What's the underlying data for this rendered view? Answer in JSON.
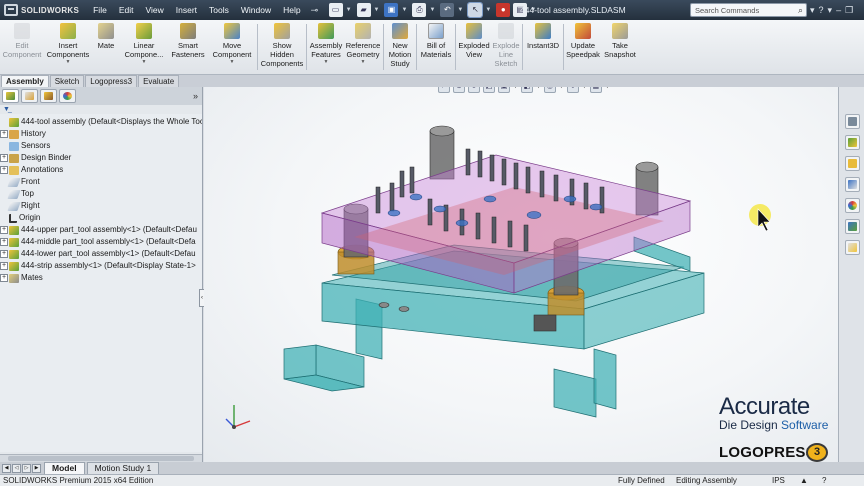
{
  "app": {
    "logo_text": "SOLIDWORKS",
    "document_title": "444-tool assembly.SLDASM",
    "search_placeholder": "Search Commands",
    "menus": [
      "File",
      "Edit",
      "View",
      "Insert",
      "Tools",
      "Window",
      "Help"
    ]
  },
  "commands": [
    {
      "label": "Edit Component",
      "icon": "edit-component-icon",
      "disabled": true,
      "dropdown": false
    },
    {
      "label": "Insert Components",
      "icon": "insert-components-icon",
      "disabled": false,
      "dropdown": true
    },
    {
      "label": "Mate",
      "icon": "mate-icon",
      "disabled": false,
      "dropdown": false
    },
    {
      "label": "Linear Compone...",
      "icon": "linear-pattern-icon",
      "disabled": false,
      "dropdown": true
    },
    {
      "label": "Smart Fasteners",
      "icon": "smart-fasteners-icon",
      "disabled": false,
      "dropdown": false
    },
    {
      "label": "Move Component",
      "icon": "move-component-icon",
      "disabled": false,
      "dropdown": true
    },
    {
      "label": "Show Hidden Components",
      "icon": "show-hidden-icon",
      "disabled": false,
      "dropdown": false
    },
    {
      "label": "Assembly Features",
      "icon": "assembly-features-icon",
      "disabled": false,
      "dropdown": true
    },
    {
      "label": "Reference Geometry",
      "icon": "reference-geometry-icon",
      "disabled": false,
      "dropdown": true
    },
    {
      "label": "New Motion Study",
      "icon": "new-motion-study-icon",
      "disabled": false,
      "dropdown": false
    },
    {
      "label": "Bill of Materials",
      "icon": "bill-of-materials-icon",
      "disabled": false,
      "dropdown": false
    },
    {
      "label": "Exploded View",
      "icon": "exploded-view-icon",
      "disabled": false,
      "dropdown": false
    },
    {
      "label": "Explode Line Sketch",
      "icon": "explode-line-sketch-icon",
      "disabled": true,
      "dropdown": false
    },
    {
      "label": "Instant3D",
      "icon": "instant3d-icon",
      "disabled": false,
      "dropdown": false
    },
    {
      "label": "Update Speedpak",
      "icon": "update-speedpak-icon",
      "disabled": false,
      "dropdown": false
    },
    {
      "label": "Take Snapshot",
      "icon": "take-snapshot-icon",
      "disabled": false,
      "dropdown": false
    }
  ],
  "command_tabs": [
    {
      "label": "Assembly",
      "active": true
    },
    {
      "label": "Sketch",
      "active": false
    },
    {
      "label": "Logopress3",
      "active": false
    },
    {
      "label": "Evaluate",
      "active": false
    }
  ],
  "tree": [
    {
      "label": "444-tool assembly  (Default<Displays the Whole Too",
      "icon": "assembly-icon",
      "expander": "",
      "indent": 0
    },
    {
      "label": "History",
      "icon": "history-icon",
      "expander": "+",
      "indent": 1
    },
    {
      "label": "Sensors",
      "icon": "sensors-icon",
      "expander": "",
      "indent": 1
    },
    {
      "label": "Design Binder",
      "icon": "design-binder-icon",
      "expander": "+",
      "indent": 1
    },
    {
      "label": "Annotations",
      "icon": "annotations-icon",
      "expander": "+",
      "indent": 1
    },
    {
      "label": "Front",
      "icon": "plane-icon",
      "expander": "",
      "indent": 1
    },
    {
      "label": "Top",
      "icon": "plane-icon",
      "expander": "",
      "indent": 1
    },
    {
      "label": "Right",
      "icon": "plane-icon",
      "expander": "",
      "indent": 1
    },
    {
      "label": "Origin",
      "icon": "origin-icon",
      "expander": "",
      "indent": 1
    },
    {
      "label": "444-upper part_tool assembly<1> (Default<Defau",
      "icon": "subassembly-icon",
      "expander": "+",
      "indent": 1
    },
    {
      "label": "444-middle part_tool assembly<1> (Default<Defa",
      "icon": "subassembly-icon",
      "expander": "+",
      "indent": 1
    },
    {
      "label": "444-lower part_tool assembly<1> (Default<Defau",
      "icon": "subassembly-icon",
      "expander": "+",
      "indent": 1
    },
    {
      "label": "444-strip assembly<1> (Default<Display State-1>",
      "icon": "subassembly-icon",
      "expander": "+",
      "indent": 1
    },
    {
      "label": "Mates",
      "icon": "mates-icon",
      "expander": "+",
      "indent": 1
    }
  ],
  "bottom_tabs": [
    {
      "label": "Model",
      "active": true
    },
    {
      "label": "Motion Study 1",
      "active": false
    }
  ],
  "status": {
    "edition": "SOLIDWORKS Premium 2015 x64 Edition",
    "definition": "Fully Defined",
    "mode": "Editing Assembly",
    "units": "IPS"
  },
  "branding": {
    "line1": "Accurate",
    "line2a": "Die Design ",
    "line2b": "Software",
    "line3": "LOGOPRESS",
    "badge": "3"
  },
  "colors": {
    "upper_plate": "#c57ed6",
    "lower_parts": "#3fb0b4",
    "guide_post": "#6b6b6b",
    "bushing": "#d8a23a",
    "accent_blue": "#3d73c4"
  }
}
